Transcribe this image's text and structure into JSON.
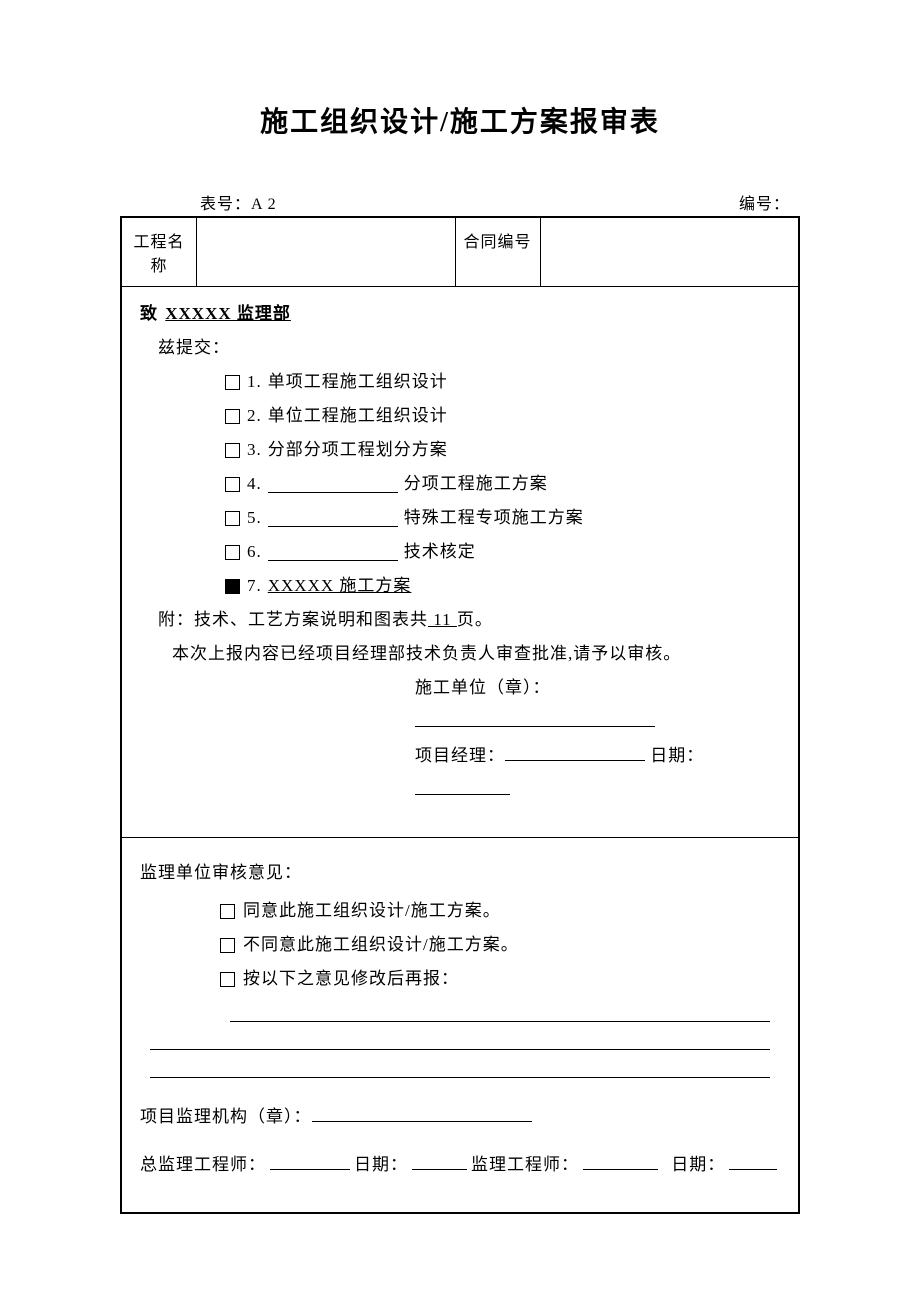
{
  "title": "施工组织设计/施工方案报审表",
  "meta": {
    "form_no_label": "表号：A 2",
    "serial_label": "编号："
  },
  "header_table": {
    "project_name_label": "工程名称",
    "project_name_value": "",
    "contract_no_label": "合同编号",
    "contract_no_value": ""
  },
  "section_a": {
    "to_prefix": "致",
    "to_name": "XXXXX 监理部",
    "submit_label": "兹提交：",
    "items": [
      {
        "num": "1.",
        "pre": "",
        "post": "单项工程施工组织设计",
        "blank": false,
        "checked": false,
        "underline": false
      },
      {
        "num": "2.",
        "pre": "",
        "post": "单位工程施工组织设计",
        "blank": false,
        "checked": false,
        "underline": false
      },
      {
        "num": "3.",
        "pre": "",
        "post": "分部分项工程划分方案",
        "blank": false,
        "checked": false,
        "underline": false
      },
      {
        "num": "4.",
        "pre": "",
        "post": "分项工程施工方案",
        "blank": true,
        "checked": false,
        "underline": false
      },
      {
        "num": "5.",
        "pre": "",
        "post": "特殊工程专项施工方案",
        "blank": true,
        "checked": false,
        "underline": false
      },
      {
        "num": "6.",
        "pre": "",
        "post": "技术核定",
        "blank": true,
        "checked": false,
        "underline": false
      },
      {
        "num": "7.",
        "pre": "XXXXX 施工方案",
        "post": "",
        "blank": false,
        "checked": true,
        "underline": true
      }
    ],
    "attach_pre": "附：技术、工艺方案说明和图表共",
    "attach_pages": "  11  ",
    "attach_post": "页。",
    "note": "本次上报内容已经项目经理部技术负责人审查批准,请予以审核。",
    "unit_label": "施工单位（章）：",
    "pm_label": "项目经理：",
    "date_label": "日期："
  },
  "section_b": {
    "opinion_label": "监理单位审核意见：",
    "options": [
      "同意此施工组织设计/施工方案。",
      "不同意此施工组织设计/施工方案。",
      "按以下之意见修改后再报："
    ],
    "org_label": "项目监理机构（章）：",
    "chief_label": "总监理工程师：",
    "date_label": "日期：",
    "engineer_label": "监理工程师："
  }
}
